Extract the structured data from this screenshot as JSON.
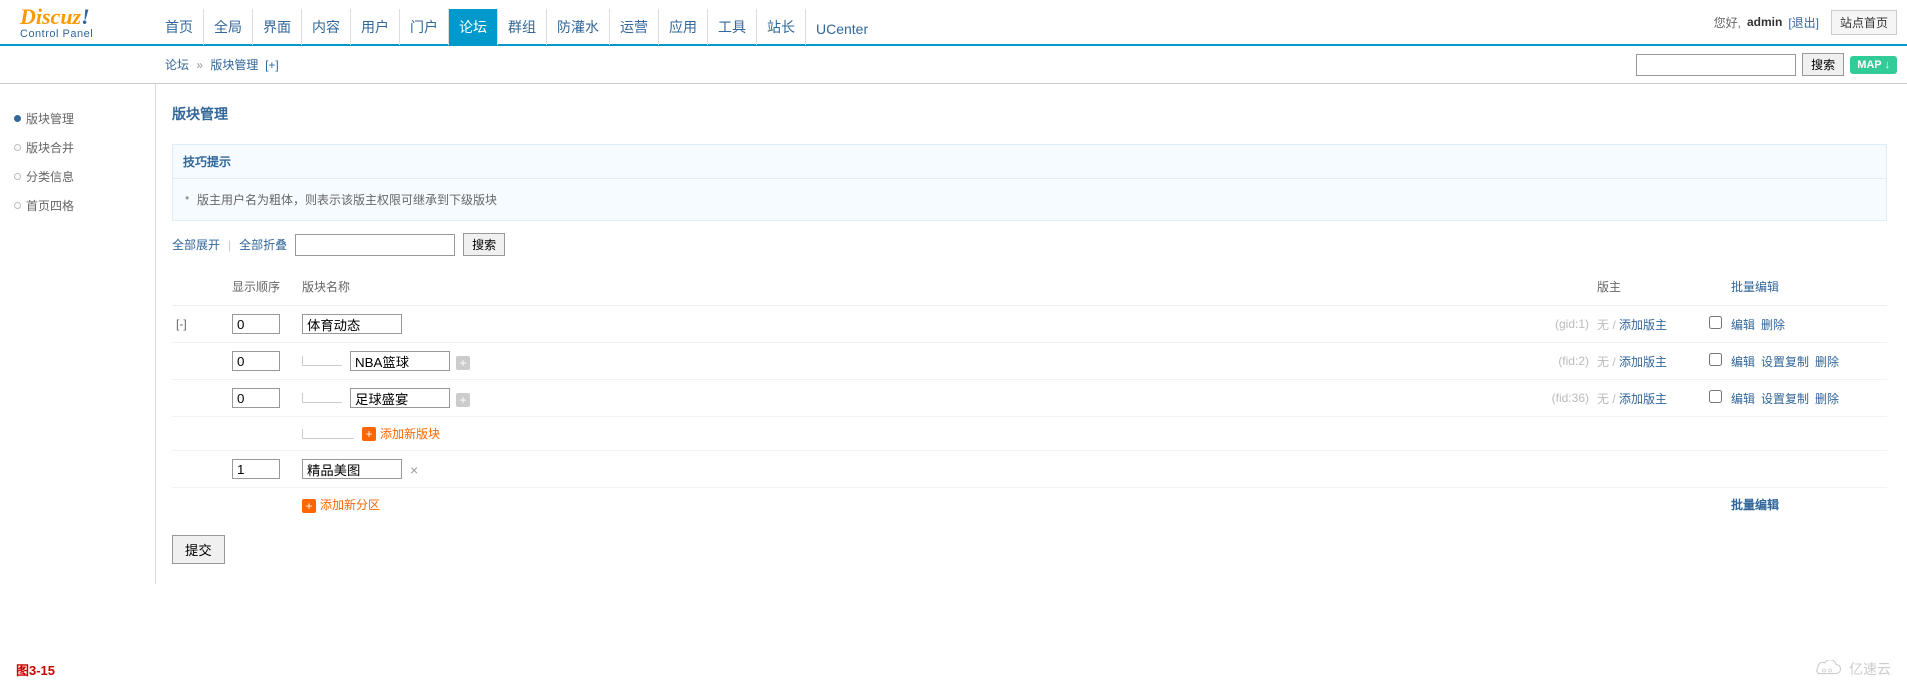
{
  "logo": {
    "text": "Discuz",
    "exclaim": "!",
    "subtitle": "Control Panel"
  },
  "user": {
    "greeting": "您好,",
    "name": "admin",
    "logout": "[退出]",
    "site_home": "站点首页"
  },
  "topnav": [
    "首页",
    "全局",
    "界面",
    "内容",
    "用户",
    "门户",
    "论坛",
    "群组",
    "防灌水",
    "运营",
    "应用",
    "工具",
    "站长",
    "UCenter"
  ],
  "topnav_active": 6,
  "breadcrumb": {
    "a": "论坛",
    "sep": "»",
    "b": "版块管理",
    "plus": "[+]"
  },
  "search_btn": "搜索",
  "map_btn": "MAP ↓",
  "sidebar": {
    "items": [
      "版块管理",
      "版块合并",
      "分类信息",
      "首页四格"
    ],
    "active": 0
  },
  "page_title": "版块管理",
  "tips": {
    "title": "技巧提示",
    "item": "版主用户名为粗体，则表示该版主权限可继承到下级版块"
  },
  "toolbar": {
    "expand_all": "全部展开",
    "collapse_all": "全部折叠",
    "search": "搜索"
  },
  "table": {
    "headers": {
      "order": "显示顺序",
      "name": "版块名称",
      "mod": "版主",
      "batch": "批量编辑"
    },
    "rows": [
      {
        "toggle": "[-]",
        "order": "0",
        "name": "体育动态",
        "indent": 0,
        "id": "(gid:1)",
        "mod_none": "无",
        "mod_add": "添加版主",
        "actions": [
          "编辑",
          "删除"
        ],
        "plus": false,
        "delx": false
      },
      {
        "toggle": "",
        "order": "0",
        "name": "NBA篮球",
        "indent": 1,
        "id": "(fid:2)",
        "mod_none": "无",
        "mod_add": "添加版主",
        "actions": [
          "编辑",
          "设置复制",
          "删除"
        ],
        "plus": true,
        "delx": false
      },
      {
        "toggle": "",
        "order": "0",
        "name": "足球盛宴",
        "indent": 1,
        "id": "(fid:36)",
        "mod_none": "无",
        "mod_add": "添加版主",
        "actions": [
          "编辑",
          "设置复制",
          "删除"
        ],
        "plus": true,
        "delx": false
      }
    ],
    "add_forum": "添加新版块",
    "row_new": {
      "order": "1",
      "name": "精品美图"
    },
    "add_category": "添加新分区",
    "batch_edit": "批量编辑"
  },
  "submit": "提交",
  "footer_label": "图3-15",
  "cloud_text": "亿速云"
}
